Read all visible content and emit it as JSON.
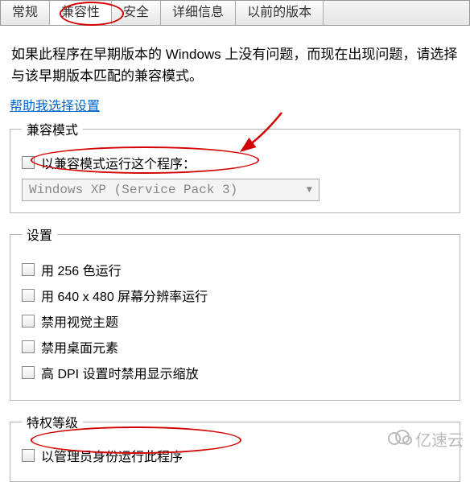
{
  "tabs": [
    "常规",
    "兼容性",
    "安全",
    "详细信息",
    "以前的版本"
  ],
  "active_tab_index": 1,
  "help_text": "如果此程序在早期版本的 Windows 上没有问题，而现在出现问题，请选择与该早期版本匹配的兼容模式。",
  "help_link": "帮助我选择设置",
  "compat": {
    "legend": "兼容模式",
    "checkbox_label": "以兼容模式运行这个程序：",
    "selected": "Windows XP (Service Pack 3)"
  },
  "settings": {
    "legend": "设置",
    "opts": [
      "用 256 色运行",
      "用 640 x 480 屏幕分辨率运行",
      "禁用视觉主题",
      "禁用桌面元素",
      "高 DPI 设置时禁用显示缩放"
    ]
  },
  "privilege": {
    "legend": "特权等级",
    "checkbox_label": "以管理员身份运行此程序"
  },
  "watermark": "亿速云"
}
